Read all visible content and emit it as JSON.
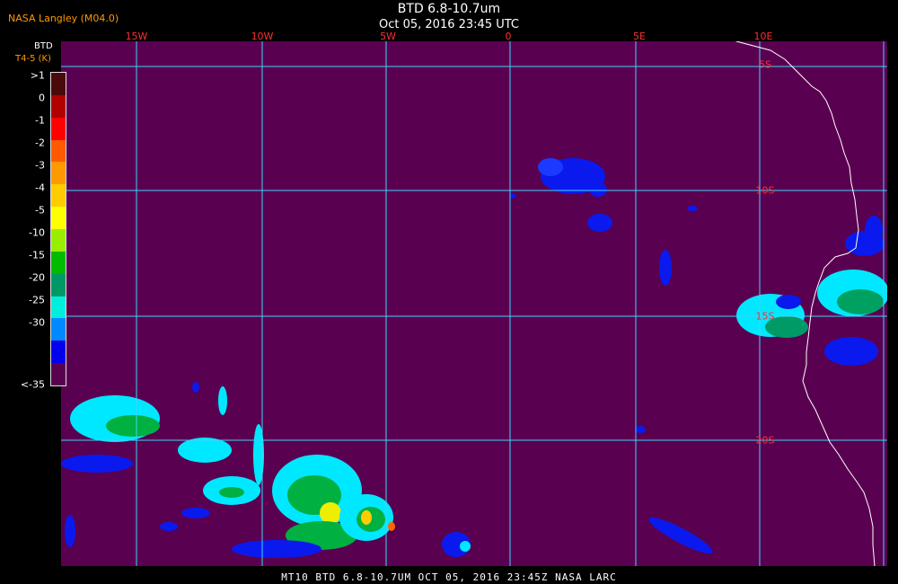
{
  "header": {
    "credit": "NASA Langley (M04.0)",
    "title": "BTD 6.8-10.7um",
    "subtitle": "Oct 05, 2016 23:45 UTC"
  },
  "legend": {
    "header_line1": "BTD",
    "header_line2": "T4-5 (K)",
    "ticks": [
      ">1",
      "0",
      "-1",
      "-2",
      "-3",
      "-4",
      "-5",
      "-10",
      "-15",
      "-20",
      "-25",
      "-30",
      "<-35"
    ],
    "colors": [
      "#4a0a0a",
      "#b00000",
      "#ff0000",
      "#ff5a00",
      "#ff9900",
      "#ffcc00",
      "#ffff00",
      "#99ee00",
      "#00bb00",
      "#009966",
      "#00eedd",
      "#0088ff",
      "#0000ee",
      "#5a0050"
    ]
  },
  "map": {
    "background_color": "#5a0050",
    "grid_color": "#3fd4ff",
    "coast_color": "#ffffff",
    "lon_labels": [
      "15W",
      "10W",
      "5W",
      "0",
      "5E",
      "10E"
    ],
    "lat_labels": [
      "5S",
      "10S",
      "15S",
      "20S"
    ]
  },
  "footer": {
    "text": "MT10   BTD 6.8-10.7UM   OCT 05, 2016 23:45Z   NASA LARC"
  }
}
